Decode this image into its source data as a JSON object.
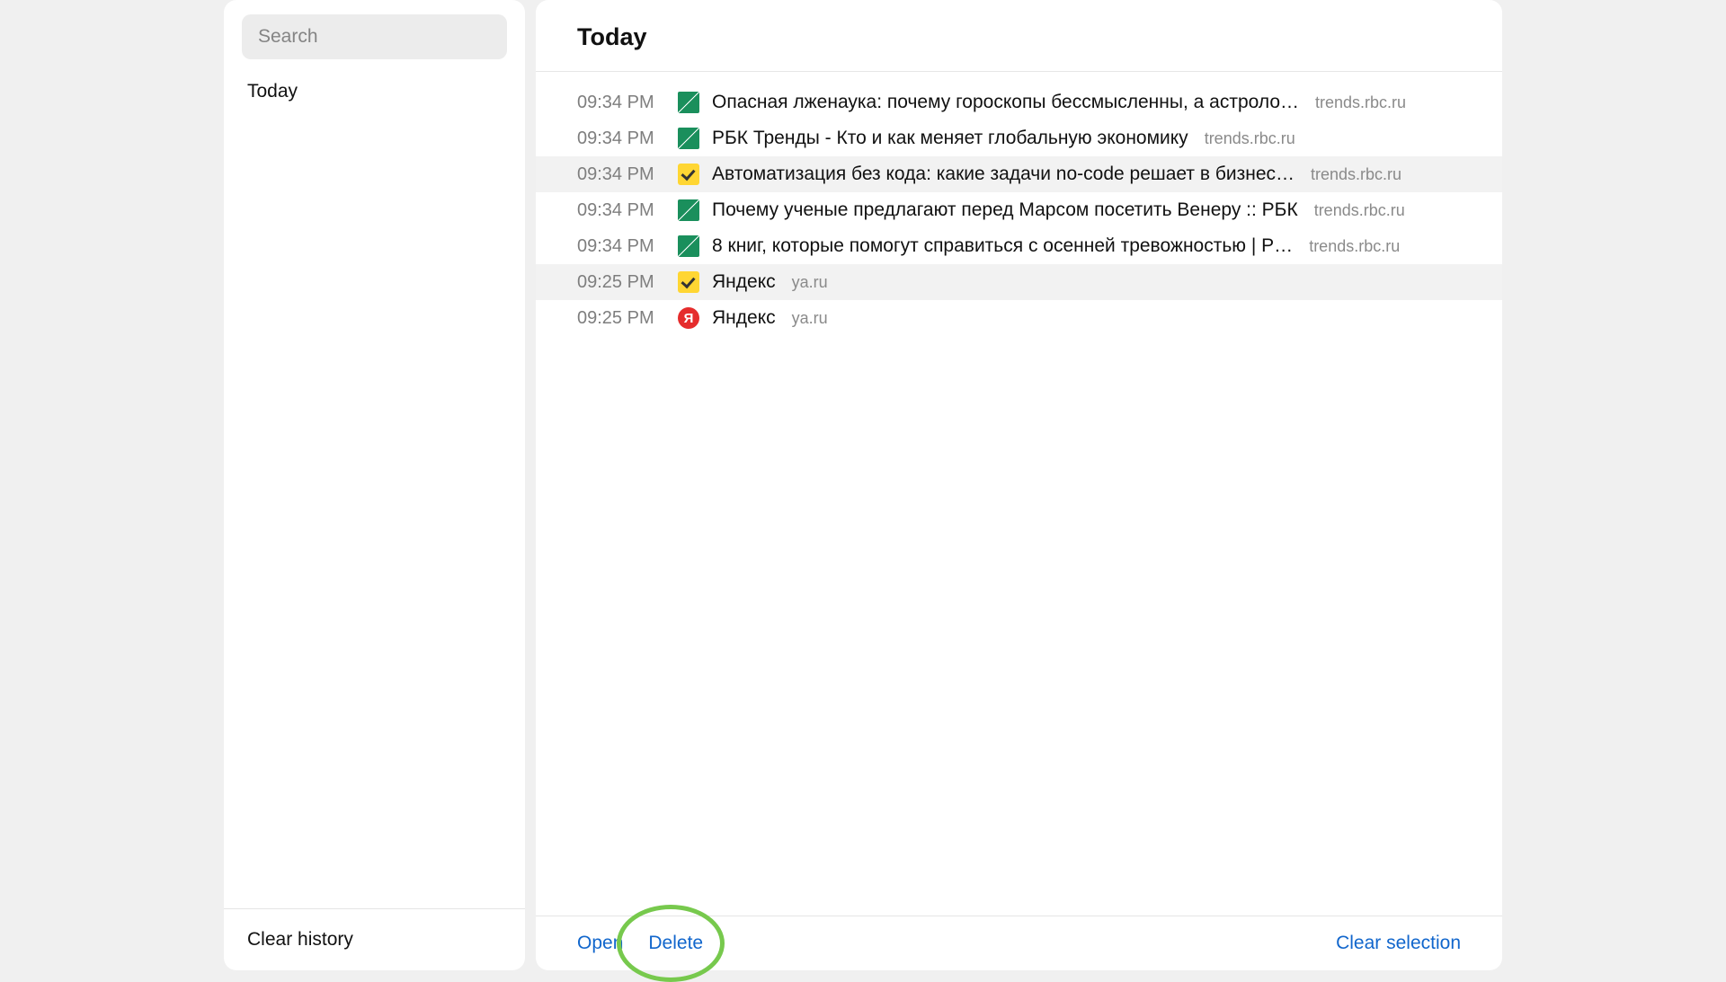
{
  "sidebar": {
    "search_placeholder": "Search",
    "items": [
      {
        "label": "Today"
      }
    ],
    "clear_history": "Clear history"
  },
  "main": {
    "heading": "Today",
    "entries": [
      {
        "time": "09:34 PM",
        "icon": "rbc",
        "title": "Опасная лженаука: почему гороскопы бессмысленны, а астроло…",
        "domain": "trends.rbc.ru",
        "selected": false
      },
      {
        "time": "09:34 PM",
        "icon": "rbc",
        "title": "РБК Тренды - Кто и как меняет глобальную экономику",
        "domain": "trends.rbc.ru",
        "selected": false
      },
      {
        "time": "09:34 PM",
        "icon": "check",
        "title": "Автоматизация без кода: какие задачи no-code решает в бизнес…",
        "domain": "trends.rbc.ru",
        "selected": true
      },
      {
        "time": "09:34 PM",
        "icon": "rbc",
        "title": "Почему ученые предлагают перед Марсом посетить Венеру :: РБК",
        "domain": "trends.rbc.ru",
        "selected": false
      },
      {
        "time": "09:34 PM",
        "icon": "rbc",
        "title": "8 книг, которые помогут справиться с осенней тревожностью | Р…",
        "domain": "trends.rbc.ru",
        "selected": false
      },
      {
        "time": "09:25 PM",
        "icon": "check",
        "title": "Яндекс",
        "domain": "ya.ru",
        "selected": true
      },
      {
        "time": "09:25 PM",
        "icon": "yandex",
        "title": "Яндекс",
        "domain": "ya.ru",
        "selected": false
      }
    ],
    "footer": {
      "open": "Open",
      "delete": "Delete",
      "clear_selection": "Clear selection"
    }
  },
  "icons": {
    "yandex_letter": "Я"
  }
}
